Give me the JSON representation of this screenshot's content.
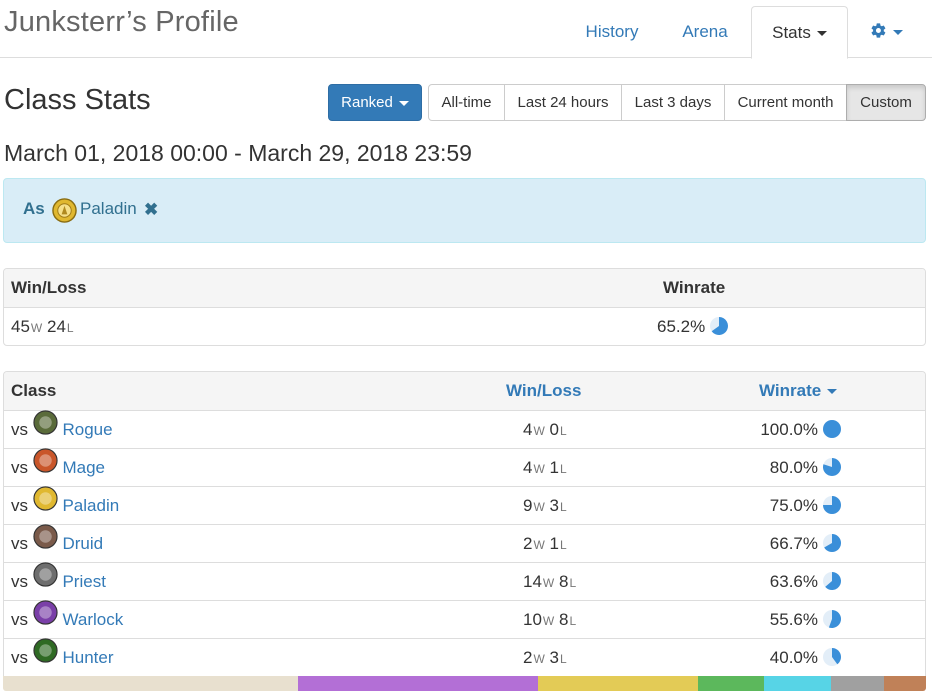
{
  "header": {
    "title": "Junksterr’s Profile",
    "tabs": [
      {
        "label": "History",
        "active": false
      },
      {
        "label": "Arena",
        "active": false
      },
      {
        "label": "Stats",
        "active": true,
        "dropdown": true
      }
    ],
    "settings_icon": "gear-icon"
  },
  "section": {
    "title": "Class Stats",
    "mode_button": "Ranked",
    "time_filters": [
      {
        "label": "All-time",
        "active": false
      },
      {
        "label": "Last 24 hours",
        "active": false
      },
      {
        "label": "Last 3 days",
        "active": false
      },
      {
        "label": "Current month",
        "active": false
      },
      {
        "label": "Custom",
        "active": true
      }
    ],
    "date_range": "March 01, 2018 00:00 - March 29, 2018 23:59"
  },
  "filter": {
    "prefix": "As",
    "class_name": "Paladin",
    "remove_icon": "✖"
  },
  "summary": {
    "headers": {
      "winloss": "Win/Loss",
      "winrate": "Winrate"
    },
    "wins": "45",
    "losses": "24",
    "w_suffix": "W",
    "l_suffix": "L",
    "winrate": "65.2%",
    "winrate_value": 65.2
  },
  "class_table": {
    "headers": {
      "class": "Class",
      "winloss": "Win/Loss",
      "winrate": "Winrate"
    },
    "vs_label": "vs",
    "rows": [
      {
        "vs": "vs",
        "class": "Rogue",
        "wins": "4",
        "losses": "0",
        "winrate": "100.0%",
        "winrate_value": 100.0,
        "icon_color": "#5a6b3a"
      },
      {
        "vs": "vs",
        "class": "Mage",
        "wins": "4",
        "losses": "1",
        "winrate": "80.0%",
        "winrate_value": 80.0,
        "icon_color": "#c9562a"
      },
      {
        "vs": "vs",
        "class": "Paladin",
        "wins": "9",
        "losses": "3",
        "winrate": "75.0%",
        "winrate_value": 75.0,
        "icon_color": "#e0b830"
      },
      {
        "vs": "vs",
        "class": "Druid",
        "wins": "2",
        "losses": "1",
        "winrate": "66.7%",
        "winrate_value": 66.7,
        "icon_color": "#7a5a4a"
      },
      {
        "vs": "vs",
        "class": "Priest",
        "wins": "14",
        "losses": "8",
        "winrate": "63.6%",
        "winrate_value": 63.6,
        "icon_color": "#6e6e6e"
      },
      {
        "vs": "vs",
        "class": "Warlock",
        "wins": "10",
        "losses": "8",
        "winrate": "55.6%",
        "winrate_value": 55.6,
        "icon_color": "#7a3fa8"
      },
      {
        "vs": "vs",
        "class": "Hunter",
        "wins": "2",
        "losses": "3",
        "winrate": "40.0%",
        "winrate_value": 40.0,
        "icon_color": "#2f6a24"
      }
    ]
  },
  "colors": {
    "accent": "#337ab7",
    "pie_fill": "#3a8fd9",
    "pie_bg": "#e3eef8",
    "info_bg": "#d9edf7",
    "info_text": "#31708f",
    "class_bar": [
      "#e8e0cf",
      "#b36fd6",
      "#e3cb56",
      "#5cb85c",
      "#57d4e6",
      "#a0a0a0",
      "#c08158"
    ]
  }
}
